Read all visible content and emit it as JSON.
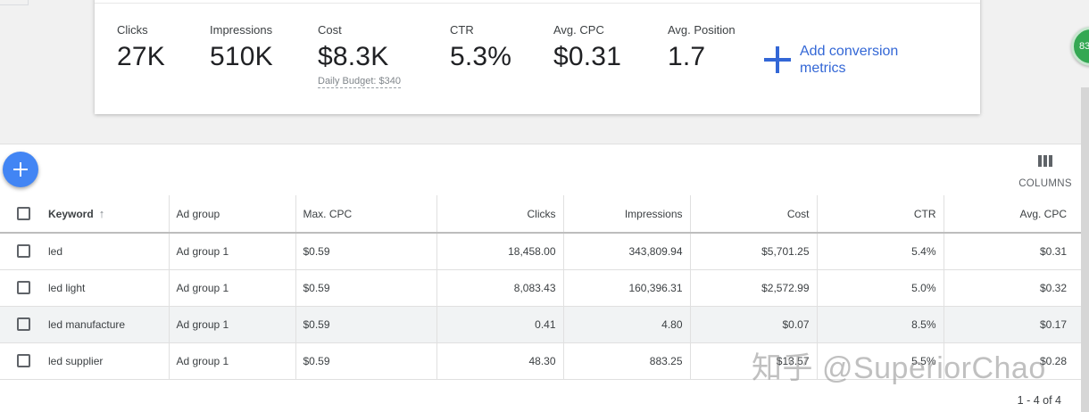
{
  "summary": {
    "metrics": [
      {
        "label": "Clicks",
        "value": "27K",
        "sub": ""
      },
      {
        "label": "Impressions",
        "value": "510K",
        "sub": ""
      },
      {
        "label": "Cost",
        "value": "$8.3K",
        "sub": "Daily Budget: $340"
      },
      {
        "label": "CTR",
        "value": "5.3%",
        "sub": ""
      },
      {
        "label": "Avg. CPC",
        "value": "$0.31",
        "sub": ""
      },
      {
        "label": "Avg. Position",
        "value": "1.7",
        "sub": ""
      }
    ],
    "add_conversion_label": "Add conversion metrics",
    "add_icon": "plus-icon"
  },
  "side_badge": {
    "text": "83",
    "color": "#34a853"
  },
  "toolbar": {
    "add_button_icon": "plus-icon",
    "columns_label": "COLUMNS",
    "columns_icon": "columns-icon"
  },
  "table": {
    "headers": {
      "keyword": "Keyword",
      "ad_group": "Ad group",
      "max_cpc": "Max. CPC",
      "clicks": "Clicks",
      "impressions": "Impressions",
      "cost": "Cost",
      "ctr": "CTR",
      "avg_cpc": "Avg. CPC"
    },
    "sort_icon": "arrow-up-icon",
    "rows": [
      {
        "keyword": "led",
        "ad_group": "Ad group 1",
        "max_cpc": "$0.59",
        "clicks": "18,458.00",
        "impressions": "343,809.94",
        "cost": "$5,701.25",
        "ctr": "5.4%",
        "avg_cpc": "$0.31"
      },
      {
        "keyword": "led light",
        "ad_group": "Ad group 1",
        "max_cpc": "$0.59",
        "clicks": "8,083.43",
        "impressions": "160,396.31",
        "cost": "$2,572.99",
        "ctr": "5.0%",
        "avg_cpc": "$0.32"
      },
      {
        "keyword": "led manufacture",
        "ad_group": "Ad group 1",
        "max_cpc": "$0.59",
        "clicks": "0.41",
        "impressions": "4.80",
        "cost": "$0.07",
        "ctr": "8.5%",
        "avg_cpc": "$0.17"
      },
      {
        "keyword": "led supplier",
        "ad_group": "Ad group 1",
        "max_cpc": "$0.59",
        "clicks": "48.30",
        "impressions": "883.25",
        "cost": "$13.57",
        "ctr": "5.5%",
        "avg_cpc": "$0.28"
      }
    ],
    "pagination": "1 - 4 of 4"
  },
  "watermark": "知乎 @SuperiorChao",
  "colors": {
    "accent": "#3367d6",
    "fab": "#4285f4",
    "badge": "#34a853"
  }
}
